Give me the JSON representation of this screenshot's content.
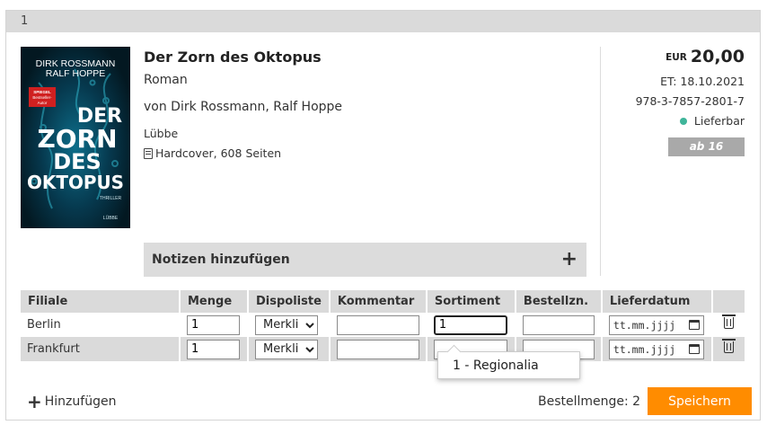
{
  "card": {
    "index": "1"
  },
  "book": {
    "cover": {
      "author_line1": "DIRK ROSSMANN",
      "author_line2": "RALF HOPPE",
      "badge_line1": "SPIEGEL",
      "badge_line2": "Bestseller-",
      "badge_line3": "Autor",
      "title_line1": "DER",
      "title_line2": "ZORN",
      "title_line3": "DES",
      "title_line4": "OKTOPUS",
      "genre": "THRILLER",
      "publisher_mark": "LÜBBE"
    },
    "title": "Der Zorn des Oktopus",
    "subtitle": "Roman",
    "authors": "von Dirk Rossmann, Ralf Hoppe",
    "publisher": "Lübbe",
    "format": "Hardcover, 608 Seiten",
    "format_icon": "book-icon"
  },
  "notes": {
    "label": "Notizen hinzufügen",
    "icon": "plus-icon"
  },
  "details": {
    "currency": "EUR",
    "price": "20,00",
    "release": "ET: 18.10.2021",
    "isbn": "978-3-7857-2801-7",
    "availability": "Lieferbar",
    "availability_color": "#3fb59a",
    "age": "ab 16 Jahren"
  },
  "table": {
    "headers": [
      "Filiale",
      "Menge",
      "Dispoliste",
      "Kommentar",
      "Sortiment",
      "Bestellzn.",
      "Lieferdatum",
      ""
    ],
    "rows": [
      {
        "filiale": "Berlin",
        "menge": "1",
        "dispoliste": "Merkliste",
        "kommentar": "",
        "sortiment": "1",
        "bestellzn": "",
        "lieferdatum_placeholder": "tt.mm.jjjj"
      },
      {
        "filiale": "Frankfurt",
        "menge": "1",
        "dispoliste": "Merkliste",
        "kommentar": "",
        "sortiment": "",
        "bestellzn": "",
        "lieferdatum_placeholder": "tt.mm.jjjj"
      }
    ]
  },
  "autocomplete": {
    "option": "1 - Regionalia"
  },
  "footer": {
    "add_label": "Hinzufügen",
    "quantity": "Bestellmenge: 2",
    "save_label": "Speichern",
    "save_color": "#ff8c00"
  }
}
